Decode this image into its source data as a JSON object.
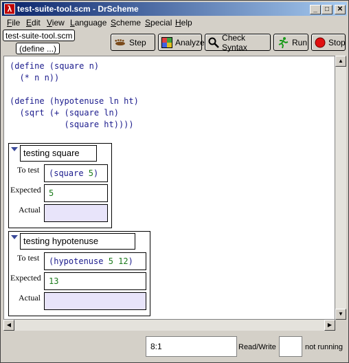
{
  "window": {
    "title": "test-suite-tool.scm - DrScheme",
    "app_icon": "λ",
    "minimize": "_",
    "maximize": "□",
    "close": "✕"
  },
  "menu": [
    {
      "label_u": "F",
      "label_rest": "ile"
    },
    {
      "label_u": "E",
      "label_rest": "dit"
    },
    {
      "label_u": "V",
      "label_rest": "iew"
    },
    {
      "label_u": "L",
      "label_rest": "anguage"
    },
    {
      "label_u": "S",
      "label_rest": "cheme"
    },
    {
      "label_u": "S",
      "label_rest": "pecial"
    },
    {
      "label_u": "H",
      "label_rest": "elp"
    }
  ],
  "file_tab": "test-suite-tool.scm",
  "define_popup": "(define ...)",
  "toolbar": {
    "step": "Step",
    "analyze": "Analyze",
    "check_syntax": "Check Syntax",
    "run": "Run",
    "stop": "Stop"
  },
  "code_lines": [
    "(define (square n)",
    "  (* n n))",
    "",
    "(define (hypotenuse ln ht)",
    "  (sqrt (+ (square ln)",
    "           (square ht))))"
  ],
  "tests": [
    {
      "name": "testing square",
      "to_test_label": "To test",
      "expected_label": "Expected",
      "actual_label": "Actual",
      "to_test_fn": "(square ",
      "to_test_args": "5",
      "to_test_close": ")",
      "expected": "5",
      "actual": ""
    },
    {
      "name": "testing hypotenuse",
      "to_test_label": "To test",
      "expected_label": "Expected",
      "actual_label": "Actual",
      "to_test_fn": "(hypotenuse ",
      "to_test_args": "5 12",
      "to_test_close": ")",
      "expected": "13",
      "actual": ""
    }
  ],
  "status": {
    "position": "8:1",
    "mode": "Read/Write",
    "running": "not running"
  }
}
